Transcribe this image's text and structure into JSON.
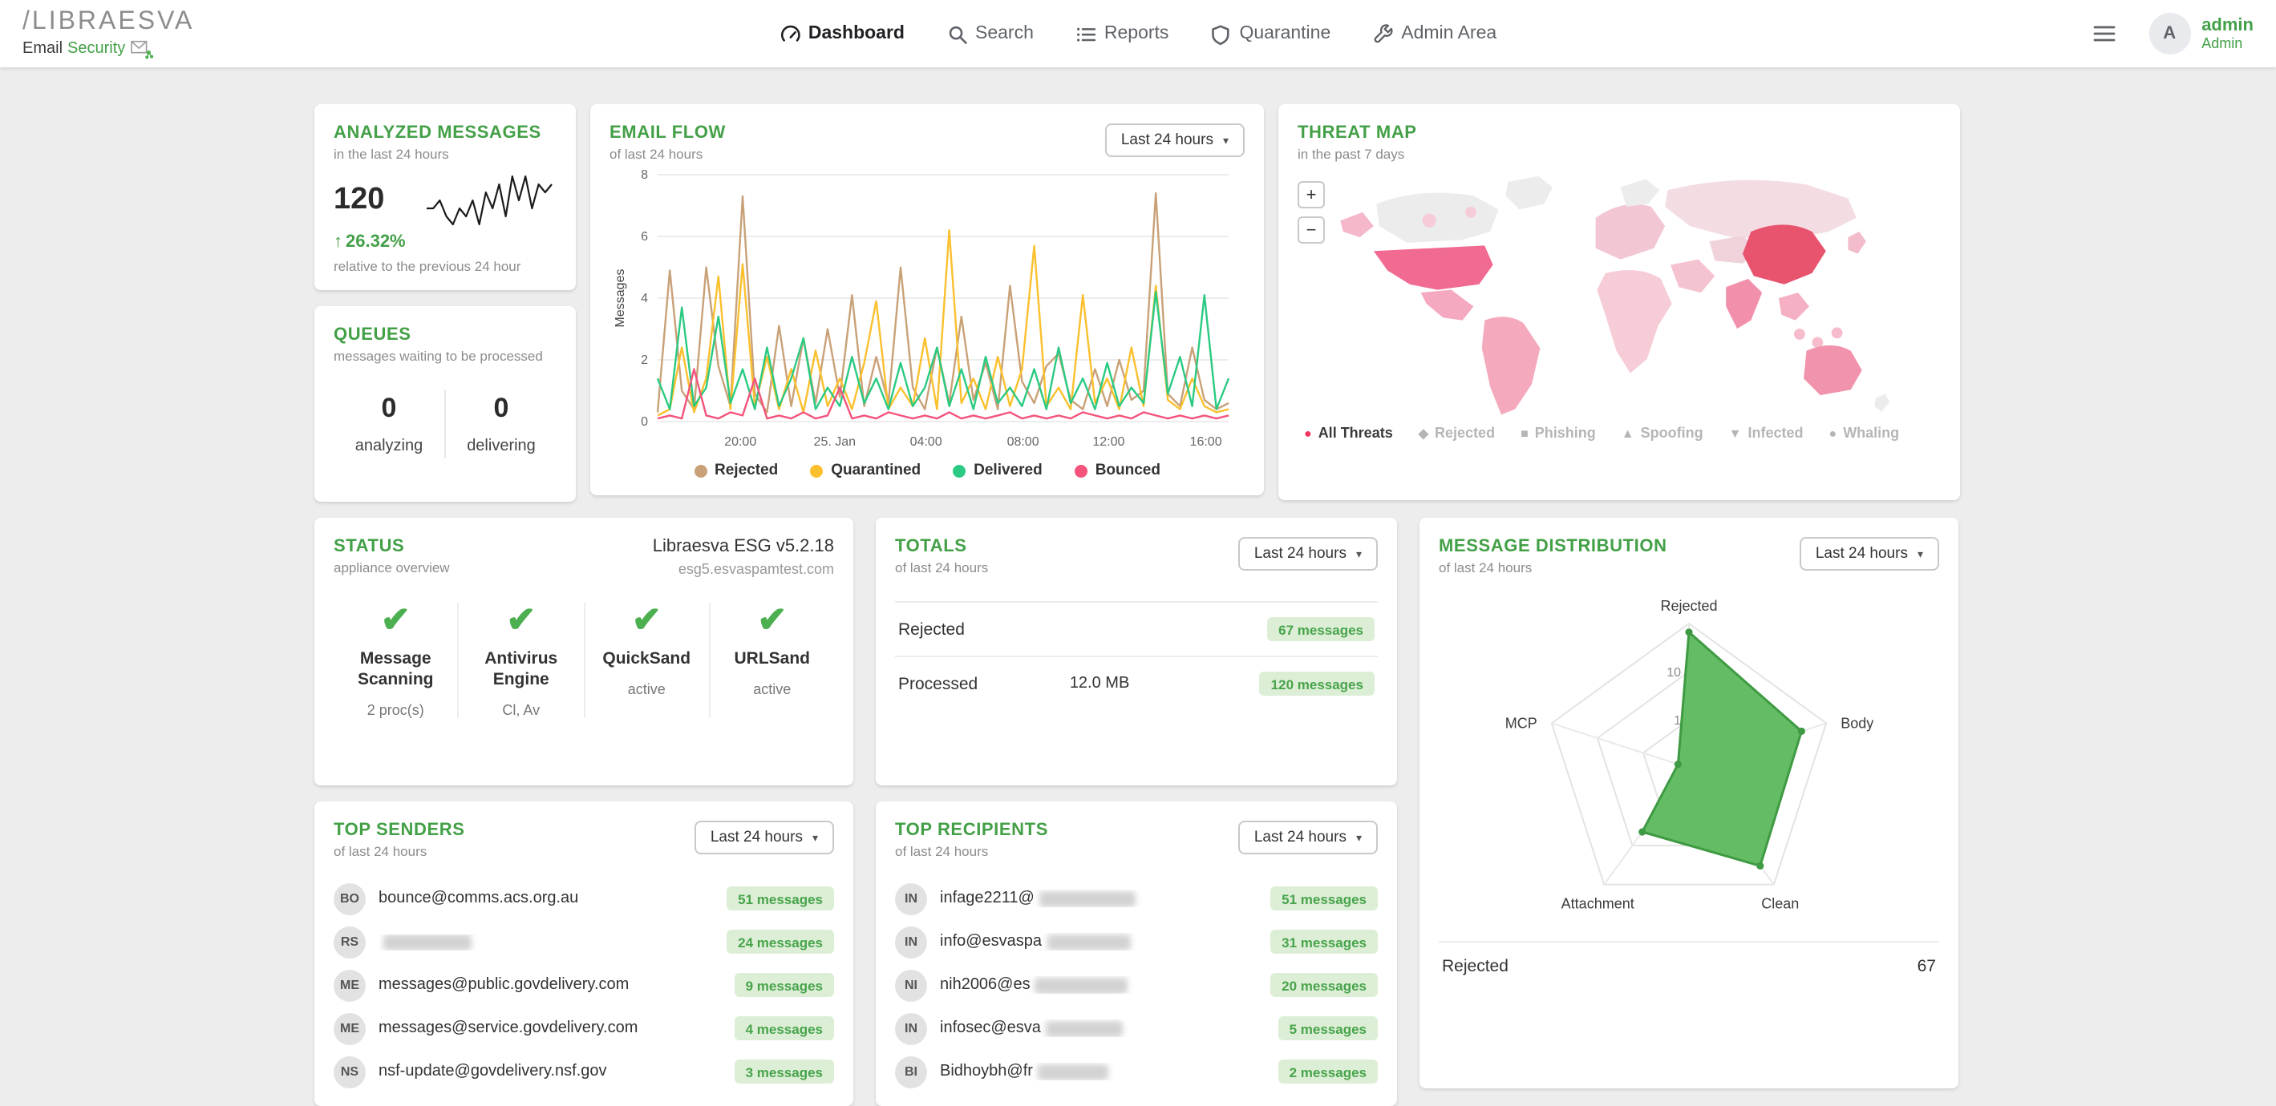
{
  "navbar": {
    "logo": {
      "title": "/LIBRAESVA",
      "brand_dark": "Email",
      "brand_green": "Security"
    },
    "items": [
      {
        "label": "Dashboard",
        "icon": "gauge-icon",
        "active": true
      },
      {
        "label": "Search",
        "icon": "search-icon",
        "active": false
      },
      {
        "label": "Reports",
        "icon": "reports-icon",
        "active": false
      },
      {
        "label": "Quarantine",
        "icon": "shield-icon",
        "active": false
      },
      {
        "label": "Admin Area",
        "icon": "wrench-icon",
        "active": false
      }
    ],
    "user": {
      "initial": "A",
      "name": "admin",
      "role": "Admin"
    }
  },
  "icons": {
    "check": "✔",
    "up_arrow": "↑",
    "caret": "▾"
  },
  "cards": {
    "analyzed": {
      "title": "ANALYZED MESSAGES",
      "subtitle": "in the last 24 hours",
      "count": "120",
      "delta": "26.32%",
      "delta_note": "relative to the previous 24 hour"
    },
    "queues": {
      "title": "QUEUES",
      "subtitle": "messages waiting to be processed",
      "stats": [
        {
          "value": "0",
          "label": "analyzing"
        },
        {
          "value": "0",
          "label": "delivering"
        }
      ]
    },
    "email_flow": {
      "title": "EMAIL FLOW",
      "subtitle": "of last 24 hours",
      "range_label": "Last 24 hours"
    },
    "threat_map": {
      "title": "THREAT MAP",
      "subtitle": "in the past 7 days",
      "zoom_in": "+",
      "zoom_out": "−",
      "legend": [
        {
          "symbol": "●",
          "label": "All Threats",
          "active": true
        },
        {
          "symbol": "◆",
          "label": "Rejected",
          "active": false
        },
        {
          "symbol": "■",
          "label": "Phishing",
          "active": false
        },
        {
          "symbol": "▲",
          "label": "Spoofing",
          "active": false
        },
        {
          "symbol": "▼",
          "label": "Infected",
          "active": false
        },
        {
          "symbol": "●",
          "label": "Whaling",
          "active": false
        }
      ]
    },
    "status": {
      "title": "STATUS",
      "subtitle": "appliance overview",
      "appliance": "Libraesva ESG v5.2.18",
      "hostname": "esg5.esvaspamtest.com",
      "checks": [
        {
          "label": "Message Scanning",
          "note": "2 proc(s)"
        },
        {
          "label": "Antivirus Engine",
          "note": "Cl, Av"
        },
        {
          "label": "QuickSand",
          "note": "active"
        },
        {
          "label": "URLSand",
          "note": "active"
        }
      ]
    },
    "totals": {
      "title": "TOTALS",
      "subtitle": "of last 24 hours",
      "range_label": "Last 24 hours",
      "rows": [
        {
          "label": "Rejected",
          "value": "",
          "badge": "67 messages"
        },
        {
          "label": "Processed",
          "value": "12.0 MB",
          "badge": "120 messages"
        }
      ]
    },
    "distribution": {
      "title": "MESSAGE DISTRIBUTION",
      "subtitle": "of last 24 hours",
      "range_label": "Last 24 hours",
      "summary_rows": [
        {
          "label": "Rejected",
          "value": "67"
        }
      ]
    },
    "top_senders": {
      "title": "TOP SENDERS",
      "subtitle": "of last 24 hours",
      "range_label": "Last 24 hours",
      "items": [
        {
          "initials": "BO",
          "email": "bounce@comms.acs.org.au",
          "redacted": false,
          "badge": "51 messages"
        },
        {
          "initials": "RS",
          "email": "",
          "redacted": true,
          "badge": "24 messages"
        },
        {
          "initials": "ME",
          "email": "messages@public.govdelivery.com",
          "redacted": false,
          "badge": "9 messages"
        },
        {
          "initials": "ME",
          "email": "messages@service.govdelivery.com",
          "redacted": false,
          "badge": "4 messages"
        },
        {
          "initials": "NS",
          "email": "nsf-update@govdelivery.nsf.gov",
          "redacted": false,
          "badge": "3 messages"
        }
      ]
    },
    "top_recipients": {
      "title": "TOP RECIPIENTS",
      "subtitle": "of last 24 hours",
      "range_label": "Last 24 hours",
      "items": [
        {
          "initials": "IN",
          "email": "infage2211@",
          "redacted": true,
          "badge": "51 messages"
        },
        {
          "initials": "IN",
          "email": "info@esvaspa",
          "redacted": true,
          "badge": "31 messages"
        },
        {
          "initials": "NI",
          "email": "nih2006@es",
          "redacted": true,
          "badge": "20 messages"
        },
        {
          "initials": "IN",
          "email": "infosec@esva",
          "redacted": true,
          "badge": "5 messages"
        },
        {
          "initials": "BI",
          "email": "Bidhoybh@fr",
          "redacted": true,
          "badge": "2 messages"
        }
      ]
    }
  },
  "chart_data": {
    "email_flow": {
      "type": "line",
      "title": "EMAIL FLOW",
      "ylabel": "Messages",
      "ylim": [
        0,
        8
      ],
      "yticks": [
        0,
        2,
        4,
        6,
        8
      ],
      "xticks": [
        {
          "label": "20:00",
          "pos": 0.145
        },
        {
          "label": "25. Jan",
          "pos": 0.31
        },
        {
          "label": "04:00",
          "pos": 0.47
        },
        {
          "label": "08:00",
          "pos": 0.64
        },
        {
          "label": "12:00",
          "pos": 0.79
        },
        {
          "label": "16:00",
          "pos": 0.96
        }
      ],
      "series": [
        {
          "name": "Rejected",
          "color": "#c9a178",
          "values": [
            0.3,
            4.9,
            1.0,
            0.4,
            5.0,
            1.8,
            0.5,
            7.3,
            0.9,
            0.3,
            3.1,
            0.5,
            2.7,
            0.6,
            3.0,
            0.8,
            4.1,
            0.5,
            2.1,
            0.6,
            5.0,
            1.1,
            0.4,
            2.4,
            0.6,
            3.4,
            0.7,
            1.9,
            0.4,
            4.4,
            1.3,
            0.6,
            1.8,
            2.2,
            0.7,
            0.4,
            1.7,
            0.5,
            2.0,
            0.7,
            1.0,
            7.4,
            0.9,
            0.5,
            2.4,
            0.7,
            0.4,
            0.6
          ]
        },
        {
          "name": "Quarantined",
          "color": "#fbc02d",
          "values": [
            0.2,
            0.4,
            2.4,
            0.3,
            1.4,
            4.7,
            0.4,
            5.1,
            0.5,
            2.1,
            0.4,
            1.7,
            0.3,
            2.3,
            0.5,
            1.4,
            0.4,
            1.9,
            3.9,
            0.4,
            1.1,
            0.5,
            2.7,
            0.4,
            6.2,
            0.6,
            1.4,
            0.4,
            2.1,
            0.5,
            1.7,
            5.7,
            0.5,
            1.1,
            0.4,
            4.1,
            0.6,
            1.4,
            0.4,
            2.4,
            0.5,
            4.4,
            0.7,
            0.4,
            1.4,
            0.5,
            0.3,
            0.4
          ]
        },
        {
          "name": "Delivered",
          "color": "#2bca82",
          "values": [
            1.4,
            0.4,
            3.7,
            0.5,
            1.1,
            3.4,
            0.6,
            1.7,
            0.4,
            2.4,
            0.5,
            1.4,
            2.7,
            0.4,
            1.1,
            0.5,
            2.1,
            0.6,
            1.4,
            0.4,
            1.9,
            0.5,
            1.1,
            2.4,
            0.5,
            1.7,
            0.4,
            2.1,
            0.6,
            1.1,
            0.5,
            1.7,
            0.4,
            2.4,
            0.6,
            1.4,
            0.4,
            1.9,
            0.5,
            1.1,
            0.6,
            4.2,
            0.9,
            2.1,
            0.5,
            4.1,
            0.4,
            1.4
          ]
        },
        {
          "name": "Bounced",
          "color": "#f4537b",
          "values": [
            0.1,
            0.2,
            0.1,
            1.7,
            0.2,
            0.1,
            0.3,
            0.2,
            1.4,
            0.1,
            0.2,
            0.1,
            0.3,
            0.1,
            0.2,
            1.1,
            0.1,
            0.2,
            0.1,
            0.3,
            0.2,
            0.1,
            0.2,
            0.1,
            0.3,
            0.1,
            0.2,
            0.1,
            0.2,
            0.3,
            0.1,
            0.2,
            0.1,
            0.2,
            0.1,
            0.3,
            0.2,
            0.1,
            0.2,
            0.1,
            0.3,
            0.2,
            0.1,
            0.2,
            0.1,
            0.2,
            0.1,
            0.2
          ]
        }
      ]
    },
    "analyzed_sparkline": {
      "type": "line",
      "color": "#1a1a1a",
      "values": [
        4,
        4,
        5,
        3,
        2,
        4,
        3,
        5,
        2,
        6,
        4,
        7,
        3,
        8,
        5,
        8,
        4,
        7,
        6,
        7
      ]
    },
    "message_distribution_radar": {
      "type": "radar",
      "axes": [
        "Rejected",
        "Body",
        "Clean",
        "Attachment",
        "MCP"
      ],
      "values_fraction": [
        0.94,
        0.82,
        0.84,
        0.55,
        0.08
      ],
      "ring_labels": [
        "10",
        "1"
      ],
      "ring_label_fractions": [
        0.667,
        0.333
      ],
      "fill": "#5cb85c",
      "stroke": "#3f9b43"
    }
  }
}
